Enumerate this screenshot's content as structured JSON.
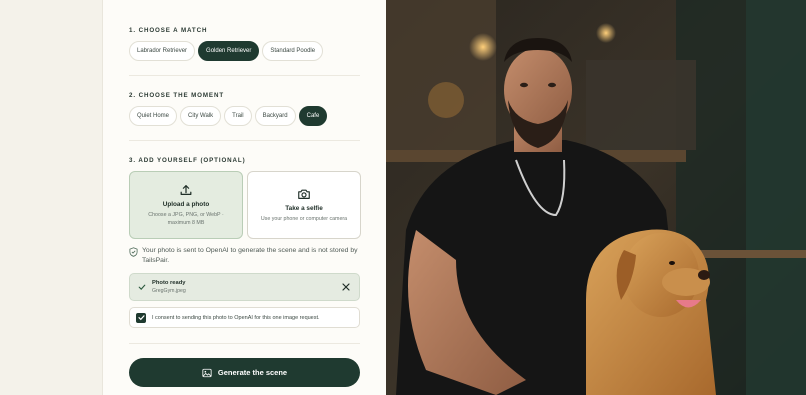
{
  "section1": {
    "title": "1. CHOOSE A MATCH",
    "chips": [
      "Labrador Retriever",
      "Golden Retriever",
      "Standard Poodle"
    ],
    "active": "Golden Retriever"
  },
  "section2": {
    "title": "2. CHOOSE THE MOMENT",
    "chips": [
      "Quiet Home",
      "City Walk",
      "Trail",
      "Backyard",
      "Cafe"
    ],
    "active": "Cafe"
  },
  "section3": {
    "title": "3. ADD YOURSELF (OPTIONAL)",
    "upload": {
      "title": "Upload a photo",
      "subtitle": "Choose a JPG, PNG, or WebP · maximum 8 MB",
      "icon": "upload-icon"
    },
    "selfie": {
      "title": "Take a selfie",
      "subtitle": "Use your phone or computer camera",
      "icon": "camera-icon"
    },
    "privacy": {
      "text": "Your photo is sent to OpenAI to generate the scene and is not stored by TailsPair.",
      "icon": "shield-check-icon"
    },
    "ready": {
      "label": "Photo ready",
      "filename": "GregGym.jpeg",
      "icon": "check-icon",
      "close_icon": "close-icon"
    },
    "consent": {
      "text": "I consent to sending this photo to OpenAI for this one image request.",
      "checked": true
    }
  },
  "generate": {
    "label": "Generate the scene",
    "icon": "image-icon"
  },
  "colors": {
    "accent": "#1f3a30",
    "panel": "#fdfcf8",
    "background": "#f3f1e9",
    "ready_bg": "#e5ebe1"
  }
}
